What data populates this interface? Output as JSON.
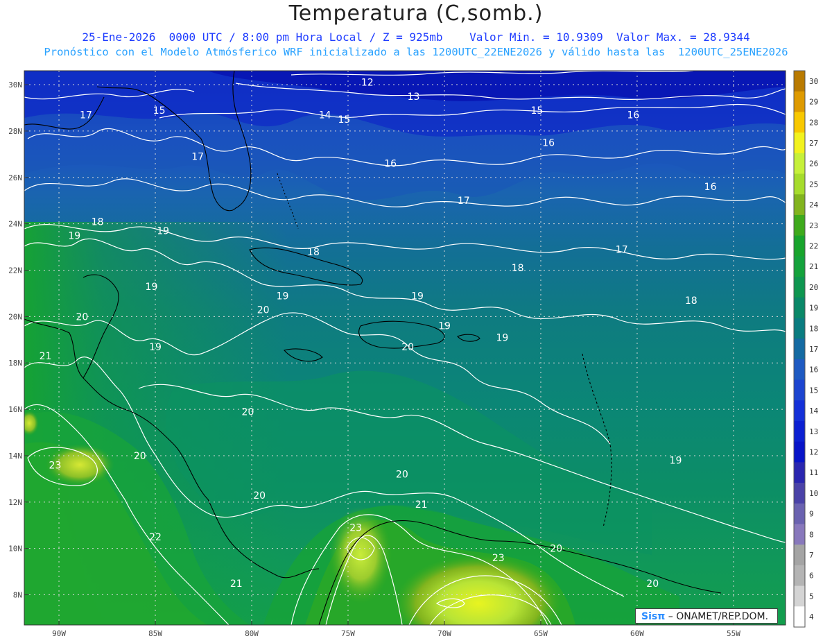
{
  "header": {
    "title": "Temperatura (C,somb.)",
    "line1": "25-Ene-2026  0000 UTC / 8:00 pm Hora Local / Z = 925mb    Valor Min. = 10.9309  Valor Max. = 28.9344",
    "line2": "Pronóstico con el Modelo Atmósferico WRF inicializado a las 1200UTC_22ENE2026 y válido hasta las  1200UTC_25ENE2026"
  },
  "map": {
    "lat_labels": [
      "30N",
      "28N",
      "26N",
      "24N",
      "22N",
      "20N",
      "18N",
      "16N",
      "14N",
      "12N",
      "10N",
      "8N"
    ],
    "lat_values": [
      30,
      28,
      26,
      24,
      22,
      20,
      18,
      16,
      14,
      12,
      10,
      8
    ],
    "lon_labels": [
      "90W",
      "85W",
      "80W",
      "75W",
      "70W",
      "65W",
      "60W",
      "55W"
    ],
    "lon_values": [
      -90,
      -85,
      -80,
      -75,
      -70,
      -65,
      -60,
      -55
    ],
    "contour_labels": [
      {
        "text": "12",
        "lon": -74.0,
        "lat": 30.1
      },
      {
        "text": "13",
        "lon": -71.6,
        "lat": 29.5
      },
      {
        "text": "15",
        "lon": -84.8,
        "lat": 28.9
      },
      {
        "text": "14",
        "lon": -76.2,
        "lat": 28.7
      },
      {
        "text": "15",
        "lon": -75.2,
        "lat": 28.5
      },
      {
        "text": "15",
        "lon": -65.2,
        "lat": 28.9
      },
      {
        "text": "16",
        "lon": -60.2,
        "lat": 28.7
      },
      {
        "text": "17",
        "lon": -88.6,
        "lat": 28.7
      },
      {
        "text": "17",
        "lon": -82.8,
        "lat": 26.9
      },
      {
        "text": "16",
        "lon": -64.6,
        "lat": 27.5
      },
      {
        "text": "16",
        "lon": -72.8,
        "lat": 26.6
      },
      {
        "text": "16",
        "lon": -56.2,
        "lat": 25.6
      },
      {
        "text": "17",
        "lon": -69.0,
        "lat": 25.0
      },
      {
        "text": "18",
        "lon": -88.0,
        "lat": 24.1
      },
      {
        "text": "19",
        "lon": -89.2,
        "lat": 23.5
      },
      {
        "text": "19",
        "lon": -84.6,
        "lat": 23.7
      },
      {
        "text": "18",
        "lon": -76.8,
        "lat": 22.8
      },
      {
        "text": "17",
        "lon": -60.8,
        "lat": 22.9
      },
      {
        "text": "18",
        "lon": -66.2,
        "lat": 22.1
      },
      {
        "text": "19",
        "lon": -85.2,
        "lat": 21.3
      },
      {
        "text": "19",
        "lon": -78.4,
        "lat": 20.9
      },
      {
        "text": "19",
        "lon": -71.4,
        "lat": 20.9
      },
      {
        "text": "18",
        "lon": -57.2,
        "lat": 20.7
      },
      {
        "text": "20",
        "lon": -79.4,
        "lat": 20.3
      },
      {
        "text": "20",
        "lon": -88.8,
        "lat": 20.0
      },
      {
        "text": "19",
        "lon": -70.0,
        "lat": 19.6
      },
      {
        "text": "19",
        "lon": -67.0,
        "lat": 19.1
      },
      {
        "text": "20",
        "lon": -71.9,
        "lat": 18.7
      },
      {
        "text": "19",
        "lon": -85.0,
        "lat": 18.7
      },
      {
        "text": "21",
        "lon": -90.7,
        "lat": 18.3
      },
      {
        "text": "20",
        "lon": -80.2,
        "lat": 15.9
      },
      {
        "text": "20",
        "lon": -85.8,
        "lat": 14.0
      },
      {
        "text": "23",
        "lon": -90.2,
        "lat": 13.6
      },
      {
        "text": "19",
        "lon": -58.0,
        "lat": 13.8
      },
      {
        "text": "20",
        "lon": -72.2,
        "lat": 13.2
      },
      {
        "text": "20",
        "lon": -79.6,
        "lat": 12.3
      },
      {
        "text": "21",
        "lon": -71.2,
        "lat": 11.9
      },
      {
        "text": "23",
        "lon": -74.6,
        "lat": 10.9
      },
      {
        "text": "22",
        "lon": -85.0,
        "lat": 10.5
      },
      {
        "text": "20",
        "lon": -64.2,
        "lat": 10.0
      },
      {
        "text": "23",
        "lon": -67.2,
        "lat": 9.6
      },
      {
        "text": "21",
        "lon": -80.8,
        "lat": 8.5
      },
      {
        "text": "20",
        "lon": -59.2,
        "lat": 8.5
      }
    ]
  },
  "colorbar": {
    "labels": [
      "30",
      "29",
      "28",
      "27",
      "26",
      "25",
      "24",
      "23",
      "22",
      "21",
      "20",
      "19",
      "18",
      "17",
      "16",
      "15",
      "14",
      "13",
      "12",
      "11",
      "10",
      "9",
      "8",
      "7",
      "6",
      "5",
      "4"
    ],
    "colors": [
      "#b97a00",
      "#de9a00",
      "#f8c800",
      "#f2f21e",
      "#c6f03a",
      "#a6dc2c",
      "#82b41e",
      "#3eaa1c",
      "#18a42c",
      "#14a23c",
      "#0e9650",
      "#0a8868",
      "#0a7c80",
      "#146aa2",
      "#1e5ac2",
      "#1c44d0",
      "#1430d8",
      "#0c20d2",
      "#0814c8",
      "#2a26b0",
      "#4a42a8",
      "#6a62b0",
      "#8878bc",
      "#a4a4a4",
      "#b4b4b4",
      "#d4d4d4",
      "#ffffff"
    ]
  },
  "credit": {
    "logo": "Sisπ",
    "text": "– ONAMET/REP.DOM."
  }
}
